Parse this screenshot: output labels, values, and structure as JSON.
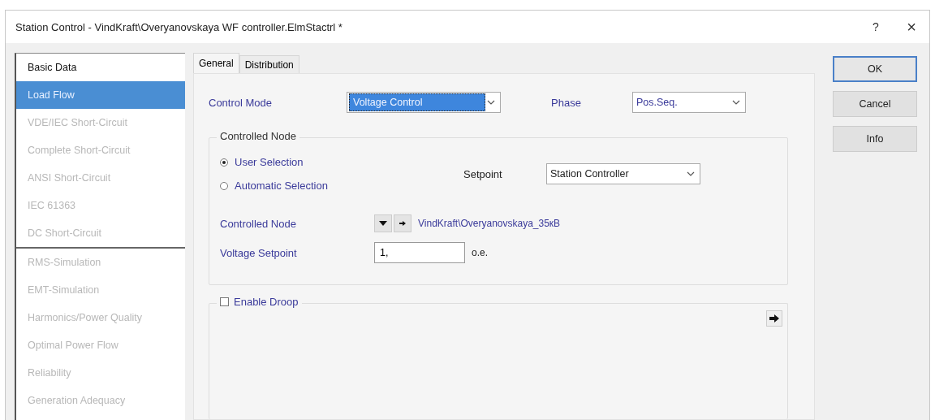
{
  "window": {
    "title": "Station Control - VindKraft\\Overyanovskaya WF controller.ElmStactrl *",
    "help": "?",
    "close": "×"
  },
  "sidebar": {
    "items": [
      {
        "label": "Basic Data",
        "selected": false,
        "disabled": false
      },
      {
        "label": "Load Flow",
        "selected": true,
        "disabled": false
      },
      {
        "label": "VDE/IEC Short-Circuit",
        "selected": false,
        "disabled": true
      },
      {
        "label": "Complete Short-Circuit",
        "selected": false,
        "disabled": true
      },
      {
        "label": "ANSI Short-Circuit",
        "selected": false,
        "disabled": true
      },
      {
        "label": "IEC 61363",
        "selected": false,
        "disabled": true
      },
      {
        "label": "DC Short-Circuit",
        "selected": false,
        "disabled": true,
        "separator_after": true
      },
      {
        "label": "RMS-Simulation",
        "selected": false,
        "disabled": true
      },
      {
        "label": "EMT-Simulation",
        "selected": false,
        "disabled": true
      },
      {
        "label": "Harmonics/Power Quality",
        "selected": false,
        "disabled": true
      },
      {
        "label": "Optimal Power Flow",
        "selected": false,
        "disabled": true
      },
      {
        "label": "Reliability",
        "selected": false,
        "disabled": true
      },
      {
        "label": "Generation Adequacy",
        "selected": false,
        "disabled": true
      }
    ]
  },
  "tabs": [
    {
      "label": "General",
      "selected": true
    },
    {
      "label": "Distribution",
      "selected": false
    }
  ],
  "control_mode": {
    "label": "Control Mode",
    "value": "Voltage Control",
    "focused": true
  },
  "phase": {
    "label": "Phase",
    "value": "Pos.Seq."
  },
  "controlled_node_group": {
    "title": "Controlled Node",
    "radios": [
      {
        "label": "User Selection",
        "selected": true
      },
      {
        "label": "Automatic Selection",
        "selected": false
      }
    ],
    "setpoint": {
      "label": "Setpoint",
      "value": "Station Controller"
    },
    "node": {
      "label": "Controlled Node",
      "value": "VindKraft\\Overyanovskaya_35кВ"
    },
    "voltage_setpoint": {
      "label": "Voltage Setpoint",
      "value": "1,",
      "unit": "o.e."
    }
  },
  "droop": {
    "label": "Enable Droop",
    "checked": false
  },
  "buttons": [
    {
      "label": "OK",
      "default": true
    },
    {
      "label": "Cancel",
      "default": false
    },
    {
      "label": "Info",
      "default": false
    }
  ]
}
